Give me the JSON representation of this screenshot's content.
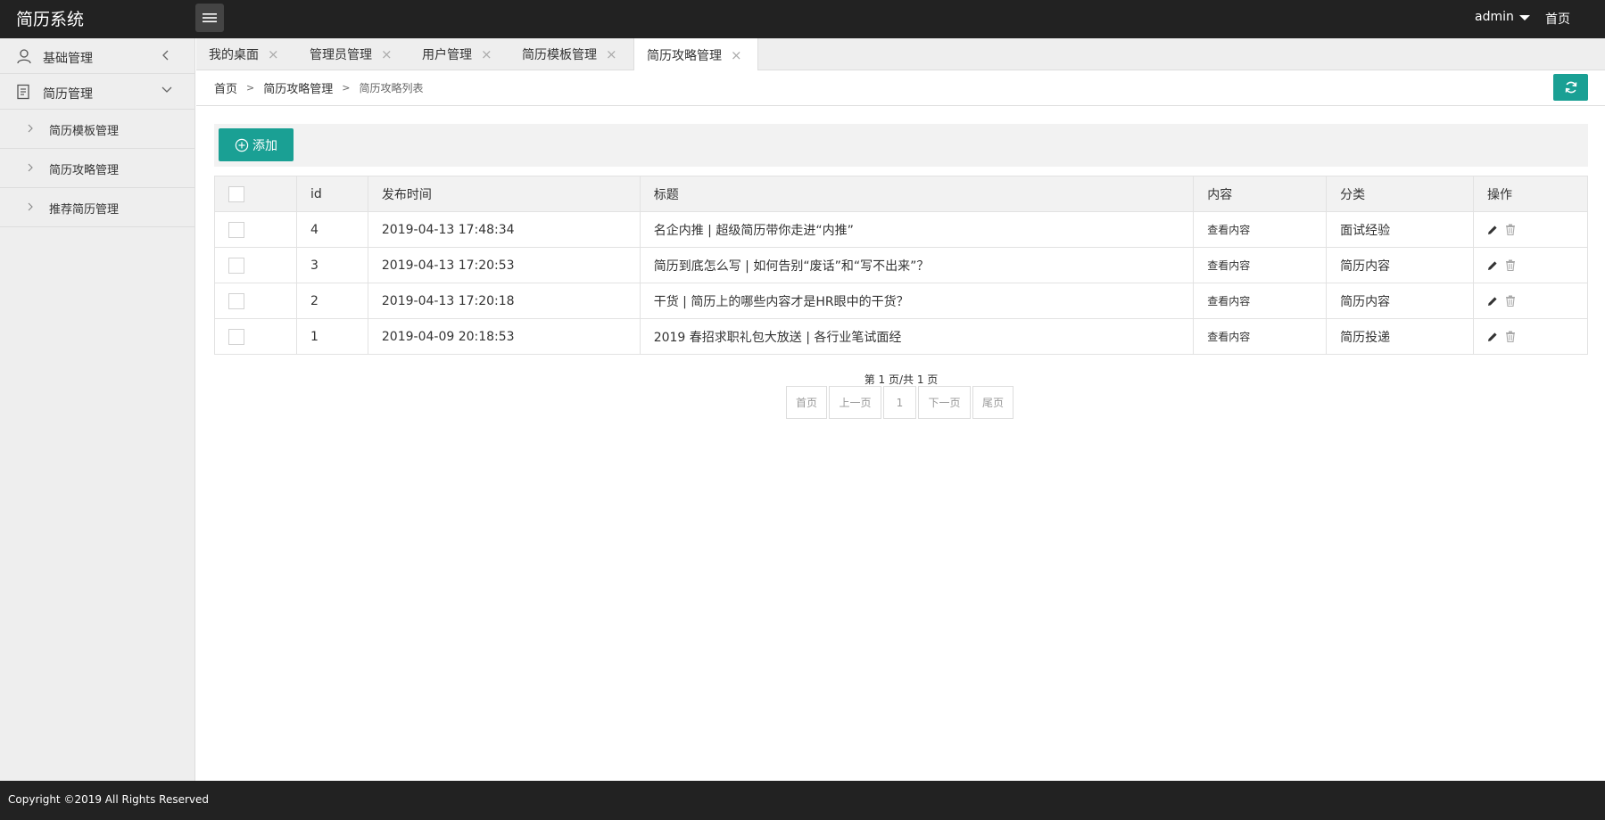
{
  "header": {
    "logo": "简历系统",
    "user": "admin",
    "home": "首页"
  },
  "sidebar": {
    "groups": [
      {
        "label": "基础管理"
      },
      {
        "label": "简历管理"
      }
    ],
    "sub_items": [
      {
        "label": "简历模板管理"
      },
      {
        "label": "简历攻略管理"
      },
      {
        "label": "推荐简历管理"
      }
    ]
  },
  "tabs": [
    {
      "label": "我的桌面"
    },
    {
      "label": "管理员管理"
    },
    {
      "label": "用户管理"
    },
    {
      "label": "简历模板管理"
    },
    {
      "label": "简历攻略管理"
    }
  ],
  "breadcrumb": {
    "home": "首页",
    "section": "简历攻略管理",
    "current": "简历攻略列表",
    "sep": ">"
  },
  "toolbar": {
    "add_label": "添加"
  },
  "table": {
    "columns": [
      "id",
      "发布时间",
      "标题",
      "内容",
      "分类",
      "操作"
    ],
    "rows": [
      {
        "id": "4",
        "time": "2019-04-13 17:48:34",
        "title": "名企内推 | 超级简历带你走进“内推”",
        "content": "查看内容",
        "category": "面试经验"
      },
      {
        "id": "3",
        "time": "2019-04-13 17:20:53",
        "title": "简历到底怎么写 | 如何告别“废话”和“写不出来”？",
        "content": "查看内容",
        "category": "简历内容"
      },
      {
        "id": "2",
        "time": "2019-04-13 17:20:18",
        "title": "干货 | 简历上的哪些内容才是HR眼中的干货？",
        "content": "查看内容",
        "category": "简历内容"
      },
      {
        "id": "1",
        "time": "2019-04-09 20:18:53",
        "title": "2019 春招求职礼包大放送 | 各行业笔试面经",
        "content": "查看内容",
        "category": "简历投递"
      }
    ]
  },
  "pagination": {
    "info": "第 1 页/共 1 页",
    "first": "首页",
    "prev": "上一页",
    "current": "1",
    "next": "下一页",
    "last": "尾页"
  },
  "footer": {
    "copyright": "Copyright ©2019 All Rights Reserved"
  },
  "colors": {
    "accent": "#1aa094",
    "header_bg": "#222222",
    "sidebar_bg": "#eeeeee"
  }
}
